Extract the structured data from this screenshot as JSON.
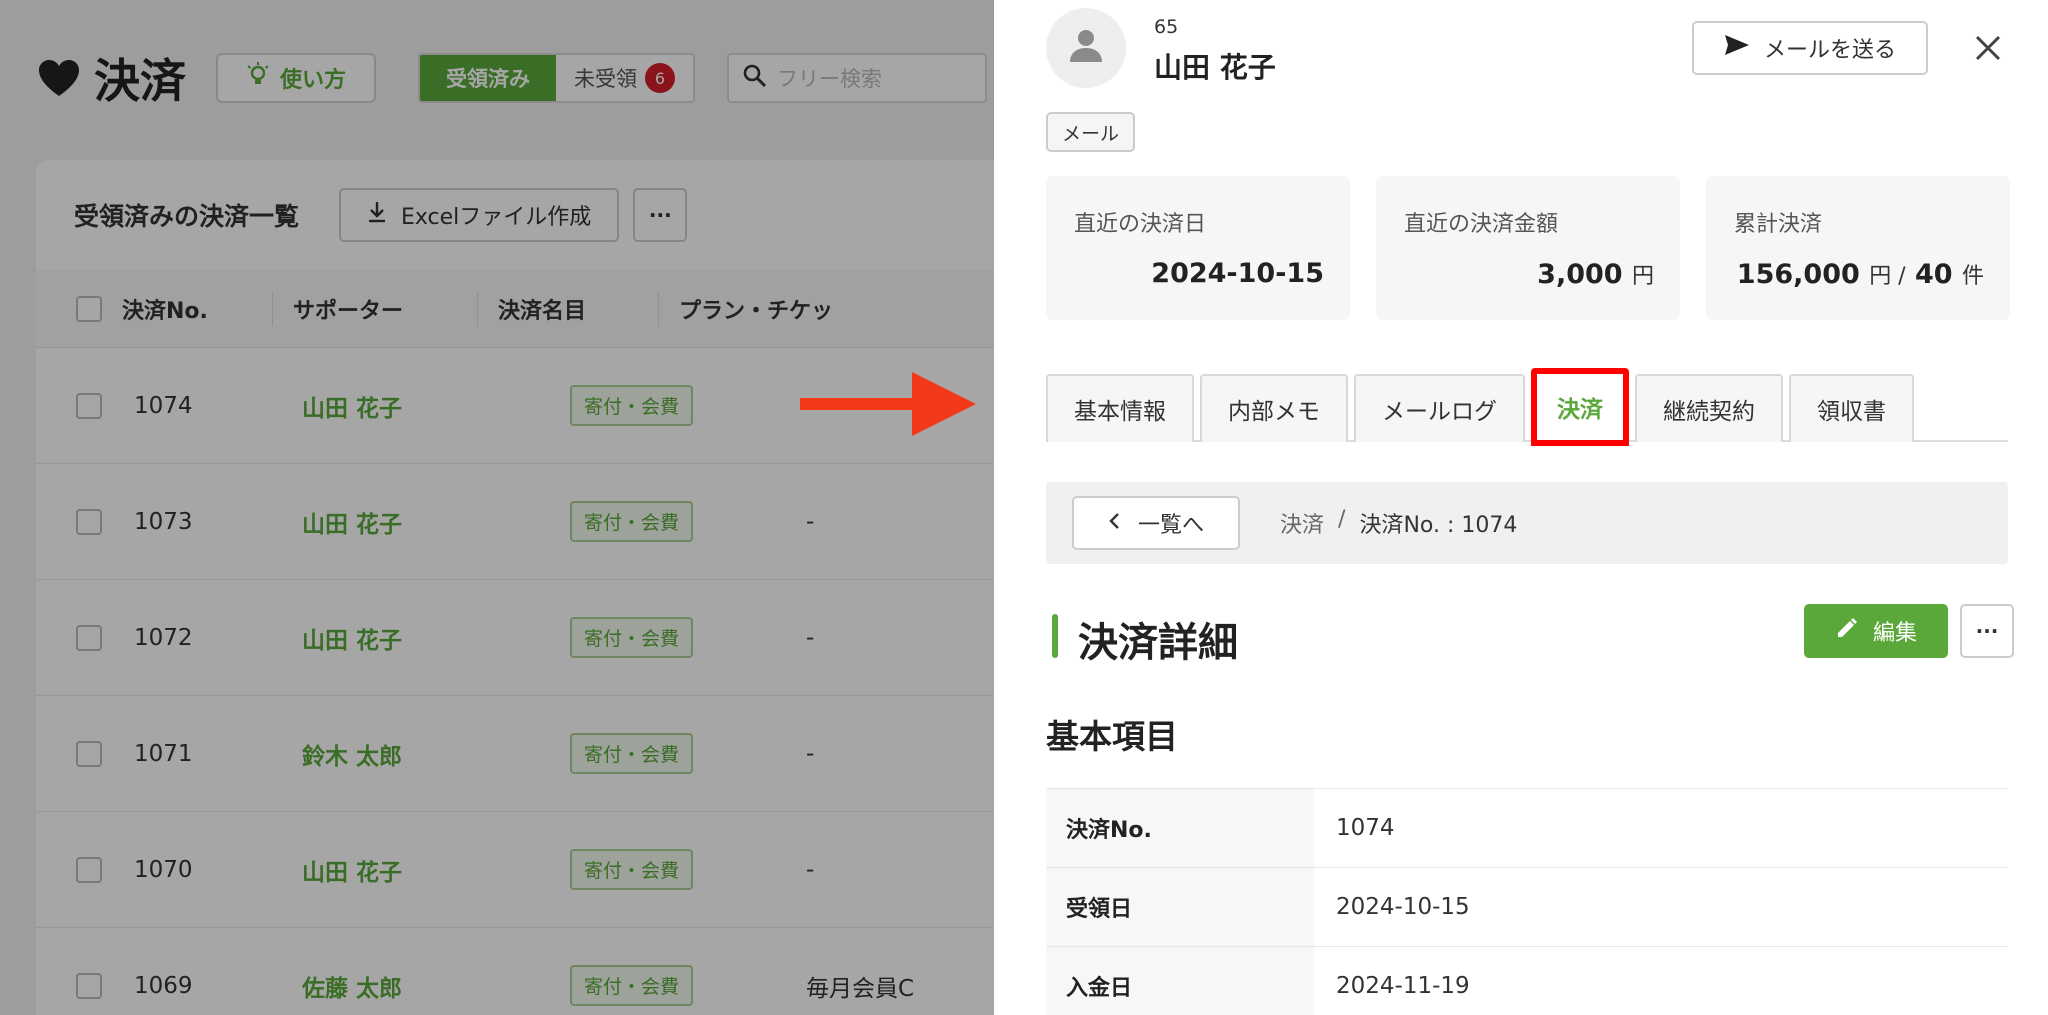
{
  "list_page": {
    "title": "決済",
    "howto_label": "使い方",
    "filter": {
      "received_label": "受領済み",
      "unreceived_label": "未受領",
      "unreceived_count": "6"
    },
    "search_placeholder": "フリー検索",
    "card_title": "受領済みの決済一覧",
    "excel_label": "Excelファイル作成",
    "more_label": "···",
    "columns": [
      "決済No.",
      "サポーター",
      "決済名目",
      "プラン・チケッ"
    ],
    "rows": [
      {
        "no": "1074",
        "supporter": "山田 花子",
        "category": "寄付・会費",
        "plan": ""
      },
      {
        "no": "1073",
        "supporter": "山田 花子",
        "category": "寄付・会費",
        "plan": "-"
      },
      {
        "no": "1072",
        "supporter": "山田 花子",
        "category": "寄付・会費",
        "plan": "-"
      },
      {
        "no": "1071",
        "supporter": "鈴木 太郎",
        "category": "寄付・会費",
        "plan": "-"
      },
      {
        "no": "1070",
        "supporter": "山田 花子",
        "category": "寄付・会費",
        "plan": "-"
      },
      {
        "no": "1069",
        "supporter": "佐藤 太郎",
        "category": "寄付・会費",
        "plan": "毎月会員C"
      }
    ]
  },
  "panel": {
    "user_id": "65",
    "user_name": "山田 花子",
    "send_mail_label": "メールを送る",
    "chip": "メール",
    "stats": [
      {
        "label": "直近の決済日",
        "value": "2024-10-15",
        "unit": ""
      },
      {
        "label": "直近の決済金額",
        "value": "3,000",
        "unit": "円"
      },
      {
        "label": "累計決済",
        "value": "156,000",
        "unit": "円 /",
        "value2": "40",
        "unit2": "件"
      }
    ],
    "tabs": [
      "基本情報",
      "内部メモ",
      "メールログ",
      "決済",
      "継続契約",
      "領収書"
    ],
    "active_tab": "決済",
    "back_label": "一覧へ",
    "breadcrumb": {
      "parent": "決済",
      "sep": "/",
      "current": "決済No. : 1074"
    },
    "section_title": "決済詳細",
    "edit_label": "編集",
    "more_label": "···",
    "subsection_title": "基本項目",
    "details": [
      {
        "key": "決済No.",
        "value": "1074"
      },
      {
        "key": "受領日",
        "value": "2024-10-15"
      },
      {
        "key": "入金日",
        "value": "2024-11-19"
      }
    ]
  },
  "colors": {
    "accent": "#5aa83a",
    "highlight": "#ff0000",
    "badge": "#d6202c",
    "arrow": "#f23a1a"
  },
  "icons": {
    "title": "heart-icon",
    "howto": "lightbulb-icon",
    "search": "search-icon",
    "excel": "download-icon",
    "avatar": "person-icon",
    "mail": "send-icon",
    "close": "close-icon",
    "back": "chevron-left-icon",
    "edit": "pencil-icon"
  }
}
